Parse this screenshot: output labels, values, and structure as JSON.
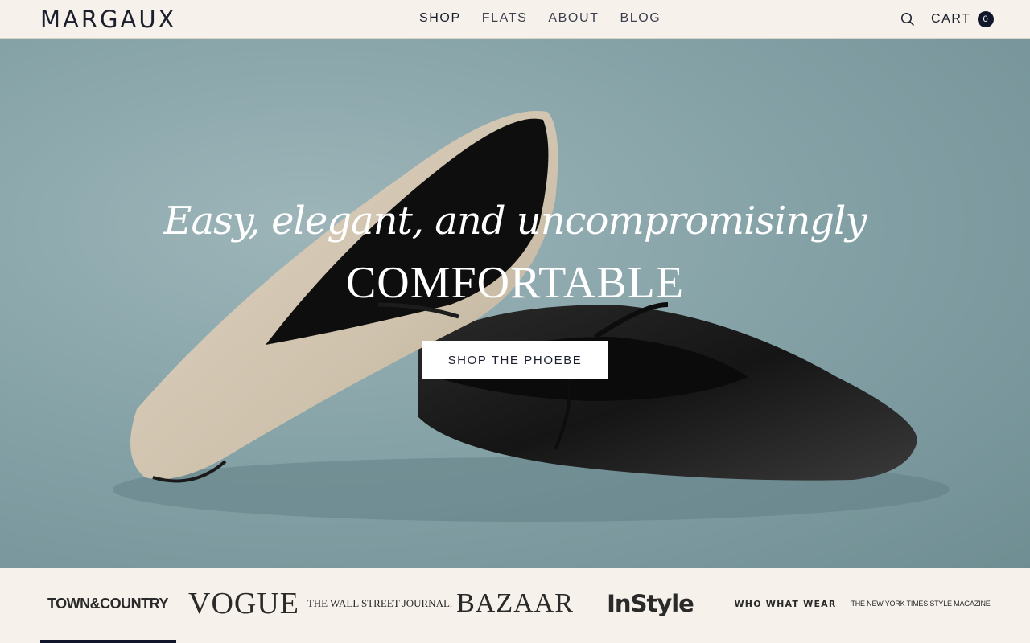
{
  "header": {
    "logo": "MARGAUX",
    "nav": [
      "SHOP",
      "FLATS",
      "ABOUT",
      "BLOG"
    ],
    "cart_label": "CART",
    "cart_count": "0"
  },
  "hero": {
    "tagline": "Easy, elegant, and uncompromisingly",
    "title": "COMFORTABLE",
    "cta": "SHOP THE PHOEBE"
  },
  "press": {
    "logos": [
      "TOWN&COUNTRY",
      "VOGUE",
      "THE WALL STREET JOURNAL.",
      "BAZAAR",
      "InStyle",
      "WHO WHAT WEAR",
      "THE NEW YORK TIMES STYLE MAGAZINE"
    ]
  },
  "colors": {
    "background": "#f6f1ea",
    "navy": "#11162b",
    "hero_teal": "#86a3a8"
  }
}
